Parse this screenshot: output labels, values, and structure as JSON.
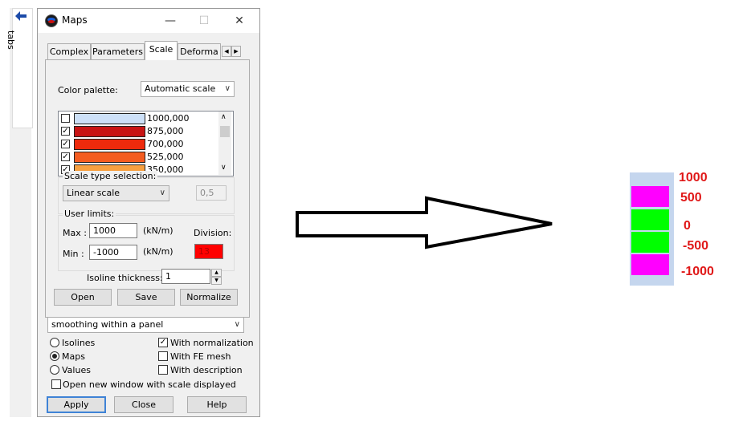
{
  "sidebar": {
    "arrow_icon": "arrow-left-icon",
    "tabs_label": "tabs"
  },
  "window": {
    "title": "Maps",
    "minimize": "—",
    "maximize": "☐",
    "close": "✕"
  },
  "tabs": [
    {
      "label": "Complex"
    },
    {
      "label": "Parameters"
    },
    {
      "label": "Scale",
      "active": true
    },
    {
      "label": "Deforma"
    }
  ],
  "tab_scroll": {
    "left": "◀",
    "right": "▶"
  },
  "scale": {
    "color_palette_label": "Color palette:",
    "color_palette_value": "Automatic scale",
    "palette": [
      {
        "checked": false,
        "color": "#cce0f8",
        "value": "1000,000"
      },
      {
        "checked": true,
        "color": "#c81414",
        "value": "875,000"
      },
      {
        "checked": true,
        "color": "#ee2a0c",
        "value": "700,000"
      },
      {
        "checked": true,
        "color": "#f45c20",
        "value": "525,000"
      },
      {
        "checked": true,
        "color": "#f7a040",
        "value": "350,000"
      }
    ],
    "check_mark": "✓",
    "scale_type_group": "Scale type selection:",
    "scale_type_value": "Linear scale",
    "scale_exponent": "0,5",
    "user_limits_group": "User limits:",
    "max_label": "Max :",
    "max_value": "1000",
    "max_unit": "(kN/m)",
    "min_label": "Min :",
    "min_value": "-1000",
    "min_unit": "(kN/m)",
    "division_label": "Division:",
    "division_value": "13",
    "division_color": "#ff0000",
    "isoline_label": "Isoline thickness:",
    "isoline_value": "1",
    "open_button": "Open",
    "save_button": "Save",
    "normalize_button": "Normalize"
  },
  "smoothing": {
    "value": "smoothing within a panel"
  },
  "display_options": {
    "isolines": {
      "label": "Isolines",
      "selected": false
    },
    "maps": {
      "label": "Maps",
      "selected": true
    },
    "values": {
      "label": "Values",
      "selected": false
    },
    "with_normalization": {
      "label": "With normalization",
      "checked": true
    },
    "with_fe_mesh": {
      "label": "With FE mesh",
      "checked": false
    },
    "with_description": {
      "label": "With description",
      "checked": false
    },
    "open_new_window": {
      "label": "Open new window with scale displayed",
      "checked": false
    }
  },
  "footer": {
    "apply": "Apply",
    "close": "Close",
    "help": "Help"
  },
  "legend": {
    "background": "#c5d6ee",
    "bands": [
      {
        "color": "#ff00ff"
      },
      {
        "color": "#00ff00"
      },
      {
        "color": "#00ff00"
      },
      {
        "color": "#ff00ff"
      }
    ],
    "labels": [
      "1000",
      "500",
      "0",
      "-500",
      "-1000"
    ],
    "label_color": "#e01818"
  }
}
